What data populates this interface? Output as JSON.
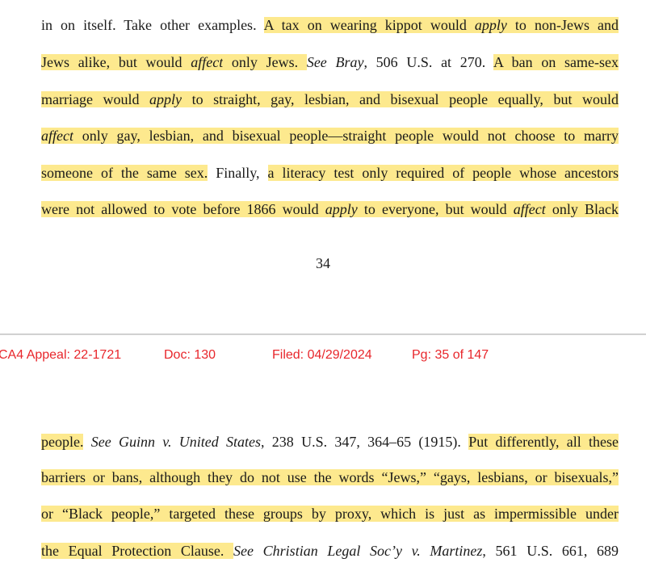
{
  "page1": {
    "lines": [
      {
        "segments": [
          {
            "t": "in on itself.  Take other examples.  ",
            "hl": false
          },
          {
            "t": "A tax on wearing kippot would ",
            "hl": true
          },
          {
            "t": "apply",
            "hl": true,
            "i": true
          },
          {
            "t": " to non-Jews and",
            "hl": true
          }
        ]
      },
      {
        "segments": [
          {
            "t": "Jews alike, but would ",
            "hl": true
          },
          {
            "t": "affect",
            "hl": true,
            "i": true
          },
          {
            "t": " only Jews.  ",
            "hl": true
          },
          {
            "t": "See Bray",
            "hl": false,
            "i": true
          },
          {
            "t": ", 506 U.S. at 270.  ",
            "hl": false
          },
          {
            "t": "A ban on same-sex",
            "hl": true
          }
        ]
      },
      {
        "segments": [
          {
            "t": "marriage would ",
            "hl": true
          },
          {
            "t": "apply",
            "hl": true,
            "i": true
          },
          {
            "t": " to straight, gay, lesbian, and bisexual people equally, but would",
            "hl": true
          }
        ]
      },
      {
        "segments": [
          {
            "t": "affect",
            "hl": true,
            "i": true
          },
          {
            "t": " only gay, lesbian, and bisexual people—straight people would not choose to marry",
            "hl": true
          }
        ]
      },
      {
        "segments": [
          {
            "t": "someone of the same sex.",
            "hl": true
          },
          {
            "t": "  Finally, ",
            "hl": false
          },
          {
            "t": "a literacy test only required of people whose ancestors",
            "hl": true
          }
        ]
      },
      {
        "segments": [
          {
            "t": "were not allowed to vote before 1866 would ",
            "hl": true
          },
          {
            "t": "apply",
            "hl": true,
            "i": true
          },
          {
            "t": " to everyone, but would ",
            "hl": true
          },
          {
            "t": "affect",
            "hl": true,
            "i": true
          },
          {
            "t": " only Black",
            "hl": true
          }
        ]
      }
    ],
    "page_number": "34"
  },
  "header": {
    "case": "CA4 Appeal: 22-1721",
    "doc": "Doc: 130",
    "filed": "Filed: 04/29/2024",
    "pg": "Pg: 35 of 147",
    "color": "#e8262b"
  },
  "page2": {
    "lines": [
      {
        "segments": [
          {
            "t": "people.",
            "hl": true
          },
          {
            "t": "  ",
            "hl": false
          },
          {
            "t": "See Guinn v. United States",
            "hl": false,
            "i": true
          },
          {
            "t": ", 238 U.S. 347, 364–65 (1915).  ",
            "hl": false
          },
          {
            "t": "Put differently, all these",
            "hl": true
          }
        ]
      },
      {
        "segments": [
          {
            "t": "barriers or bans, although they do not use the words “Jews,” “gays, lesbians, or bisexuals,”",
            "hl": true
          }
        ]
      },
      {
        "segments": [
          {
            "t": "or “Black people,” targeted these groups by proxy, which is just as impermissible under",
            "hl": true
          }
        ]
      },
      {
        "segments": [
          {
            "t": "the Equal Protection Clause.  ",
            "hl": true
          },
          {
            "t": "See Christian Legal Soc’y v. Martinez",
            "hl": false,
            "i": true
          },
          {
            "t": ", 561 U.S. 661, 689",
            "hl": false
          }
        ]
      }
    ]
  },
  "highlight_color": "#fde98e"
}
